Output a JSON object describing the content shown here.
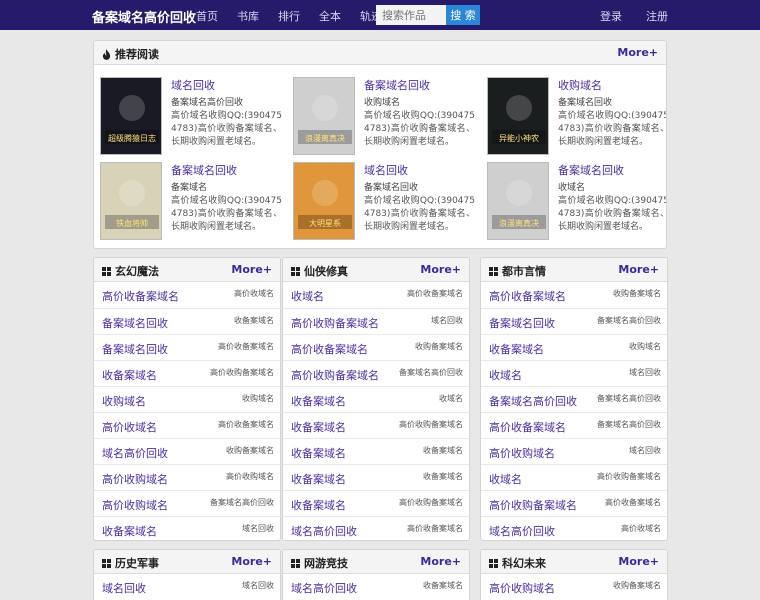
{
  "header": {
    "brand": "备案域名高价回收",
    "nav": [
      "首页",
      "书库",
      "排行",
      "全本",
      "轨迹"
    ],
    "search_placeholder": "搜索作品",
    "search_button": "搜 索",
    "login": "登录",
    "register": "注册"
  },
  "recommend": {
    "title": "推荐阅读",
    "more": "More+",
    "items": [
      {
        "title": "域名回收",
        "author": "备案域名高价回收",
        "desc": "高价域名收购QQ:(3904754783)高价收购备案域名、长期收购闲置老域名。",
        "cover_text": "超级腾猿日志",
        "cover_bg": "#1a1a24"
      },
      {
        "title": "备案域名回收",
        "author": "收购域名",
        "desc": "高价域名收购QQ:(3904754783)高价收购备案域名、长期收购闲置老域名。",
        "cover_text": "浪漫离真决",
        "cover_bg": "#cfcfcf"
      },
      {
        "title": "收购域名",
        "author": "备案域名回收",
        "desc": "高价域名收购QQ:(3904754783)高价收购备案域名、长期收购闲置老域名。",
        "cover_text": "异能小神农",
        "cover_bg": "#1b1e1f"
      },
      {
        "title": "备案域名回收",
        "author": "备案域名",
        "desc": "高价域名收购QQ:(3904754783)高价收购备案域名、长期收购闲置老域名。",
        "cover_text": "铁血将帅",
        "cover_bg": "#d8d2b8"
      },
      {
        "title": "域名回收",
        "author": "备案域名回收",
        "desc": "高价域名收购QQ:(3904754783)高价收购备案域名、长期收购闲置老域名。",
        "cover_text": "大明星系",
        "cover_bg": "#e0963a"
      },
      {
        "title": "备案域名回收",
        "author": "收域名",
        "desc": "高价域名收购QQ:(3904754783)高价收购备案域名、长期收购闲置老域名。",
        "cover_text": "浪漫离真决",
        "cover_bg": "#cfcfcf"
      }
    ]
  },
  "categories": [
    {
      "title": "玄幻魔法",
      "more": "More+",
      "rows": [
        {
          "title": "高价收备案域名",
          "author": "高价收域名"
        },
        {
          "title": "备案域名回收",
          "author": "收备案域名"
        },
        {
          "title": "备案域名回收",
          "author": "高价收备案域名"
        },
        {
          "title": "收备案域名",
          "author": "高价收购备案域名"
        },
        {
          "title": "收购域名",
          "author": "收购域名"
        },
        {
          "title": "高价收域名",
          "author": "高价收备案域名"
        },
        {
          "title": "域名高价回收",
          "author": "收购备案域名"
        },
        {
          "title": "高价收购域名",
          "author": "高价收购域名"
        },
        {
          "title": "高价收购域名",
          "author": "备案域名高价回收"
        },
        {
          "title": "收备案域名",
          "author": "域名回收"
        }
      ]
    },
    {
      "title": "仙侠修真",
      "more": "More+",
      "rows": [
        {
          "title": "收域名",
          "author": "高价收备案域名"
        },
        {
          "title": "高价收购备案域名",
          "author": "域名回收"
        },
        {
          "title": "高价收备案域名",
          "author": "收购备案域名"
        },
        {
          "title": "高价收购备案域名",
          "author": "备案域名高价回收"
        },
        {
          "title": "收备案域名",
          "author": "收域名"
        },
        {
          "title": "收备案域名",
          "author": "高价收购备案域名"
        },
        {
          "title": "收备案域名",
          "author": "收备案域名"
        },
        {
          "title": "收备案域名",
          "author": "收备案域名"
        },
        {
          "title": "收备案域名",
          "author": "高价收购备案域名"
        },
        {
          "title": "域名高价回收",
          "author": "高价收备案域名"
        }
      ]
    },
    {
      "title": "都市言情",
      "more": "More+",
      "rows": [
        {
          "title": "高价收备案域名",
          "author": "收购备案域名"
        },
        {
          "title": "备案域名回收",
          "author": "备案域名高价回收"
        },
        {
          "title": "收备案域名",
          "author": "收购域名"
        },
        {
          "title": "收域名",
          "author": "域名回收"
        },
        {
          "title": "备案域名高价回收",
          "author": "备案域名高价回收"
        },
        {
          "title": "高价收备案域名",
          "author": "备案域名高价回收"
        },
        {
          "title": "高价收购域名",
          "author": "域名回收"
        },
        {
          "title": "收域名",
          "author": "高价收购备案域名"
        },
        {
          "title": "高价收购备案域名",
          "author": "高价收备案域名"
        },
        {
          "title": "域名高价回收",
          "author": "高价收域名"
        }
      ]
    },
    {
      "title": "历史军事",
      "more": "More+",
      "rows": [
        {
          "title": "域名回收",
          "author": "域名回收"
        }
      ]
    },
    {
      "title": "网游竞技",
      "more": "More+",
      "rows": [
        {
          "title": "域名高价回收",
          "author": "收备案域名"
        }
      ]
    },
    {
      "title": "科幻未来",
      "more": "More+",
      "rows": [
        {
          "title": "高价收购域名",
          "author": "收购备案域名"
        }
      ]
    }
  ]
}
